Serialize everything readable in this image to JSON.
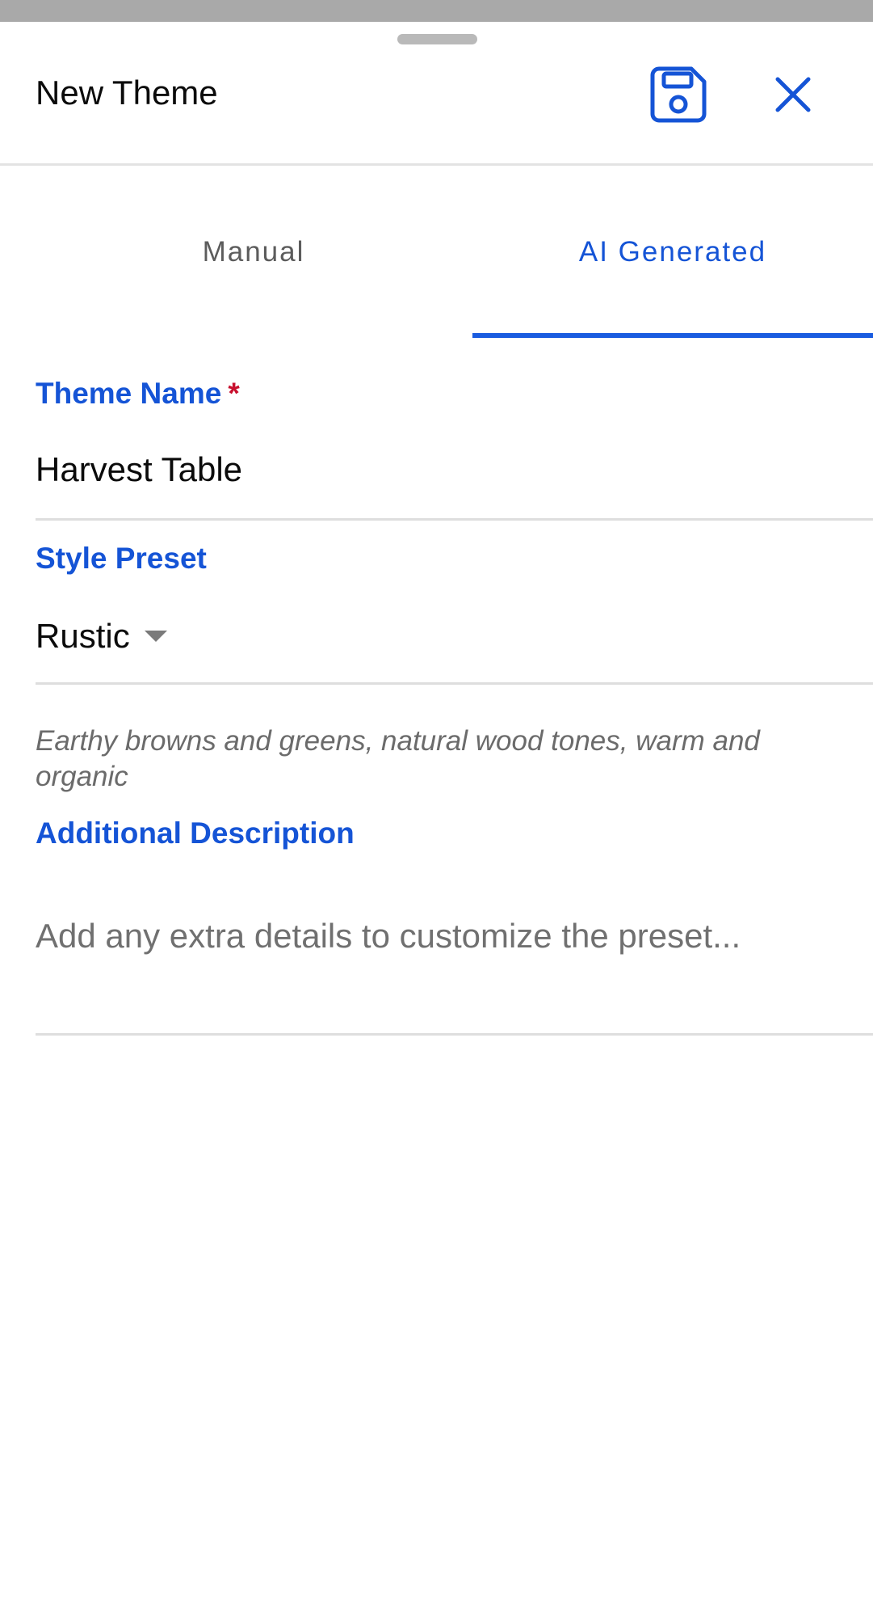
{
  "header": {
    "title": "New Theme"
  },
  "tabs": [
    {
      "label": "Manual",
      "active": false
    },
    {
      "label": "AI Generated",
      "active": true
    }
  ],
  "form": {
    "theme_name": {
      "label": "Theme Name",
      "required_marker": "*",
      "value": "Harvest Table"
    },
    "style_preset": {
      "label": "Style Preset",
      "value": "Rustic",
      "hint": "Earthy browns and greens, natural wood tones, warm and organic"
    },
    "additional_description": {
      "label": "Additional Description",
      "placeholder": "Add any extra details to customize the preset..."
    }
  },
  "icons": {
    "save": "save-icon",
    "close": "close-icon",
    "dropdown": "caret-down-icon"
  },
  "colors": {
    "accent": "#1554d6",
    "required": "#c8102e",
    "divider": "#dedede",
    "top_strip": "#a9a9a9"
  }
}
